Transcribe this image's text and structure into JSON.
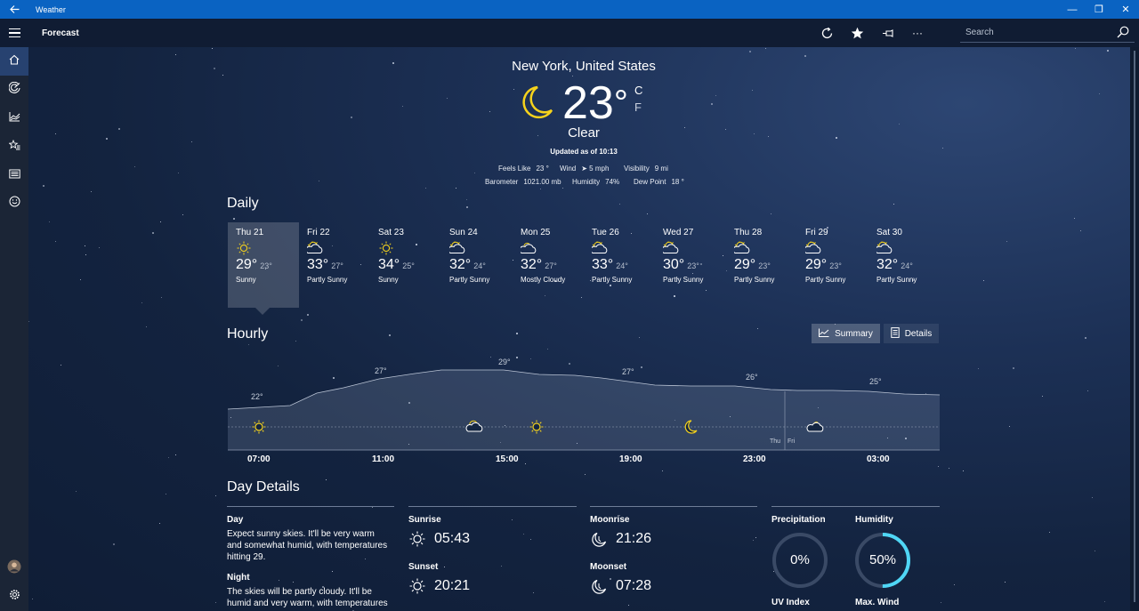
{
  "window": {
    "app_title": "Weather",
    "back_icon": "back-arrow-icon",
    "minimize": "—",
    "restore": "❐",
    "close": "✕"
  },
  "command_bar": {
    "title": "Forecast",
    "search_placeholder": "Search",
    "more": "···"
  },
  "current": {
    "location": "New York, United States",
    "temperature": "23",
    "degree": "°",
    "unit_c": "C",
    "unit_f": "F",
    "condition": "Clear",
    "updated": "Updated as of 10:13",
    "feels_like_label": "Feels Like",
    "feels_like": "23 °",
    "wind_label": "Wind",
    "wind": "➤ 5 mph",
    "visibility_label": "Visibility",
    "visibility": "9 mi",
    "barometer_label": "Barometer",
    "barometer": "1021.00 mb",
    "humidity_label": "Humidity",
    "humidity": "74%",
    "dewpoint_label": "Dew Point",
    "dewpoint": "18 °"
  },
  "daily": {
    "heading": "Daily",
    "days": [
      {
        "name": "Thu 21",
        "hi": "29°",
        "lo": "23°",
        "cond": "Sunny",
        "icon": "sun-icon"
      },
      {
        "name": "Fri 22",
        "hi": "33°",
        "lo": "27°",
        "cond": "Partly Sunny",
        "icon": "partly-sunny-icon"
      },
      {
        "name": "Sat 23",
        "hi": "34°",
        "lo": "25°",
        "cond": "Sunny",
        "icon": "sun-icon"
      },
      {
        "name": "Sun 24",
        "hi": "32°",
        "lo": "24°",
        "cond": "Partly Sunny",
        "icon": "partly-sunny-icon"
      },
      {
        "name": "Mon 25",
        "hi": "32°",
        "lo": "27°",
        "cond": "Mostly Cloudy",
        "icon": "mostly-cloudy-icon"
      },
      {
        "name": "Tue 26",
        "hi": "33°",
        "lo": "24°",
        "cond": "Partly Sunny",
        "icon": "partly-sunny-icon"
      },
      {
        "name": "Wed 27",
        "hi": "30°",
        "lo": "23°",
        "cond": "Partly Sunny",
        "icon": "partly-sunny-icon"
      },
      {
        "name": "Thu 28",
        "hi": "29°",
        "lo": "23°",
        "cond": "Partly Sunny",
        "icon": "partly-sunny-icon"
      },
      {
        "name": "Fri 29",
        "hi": "29°",
        "lo": "23°",
        "cond": "Partly Sunny",
        "icon": "partly-sunny-icon"
      },
      {
        "name": "Sat 30",
        "hi": "32°",
        "lo": "24°",
        "cond": "Partly Sunny",
        "icon": "partly-sunny-icon"
      }
    ]
  },
  "hourly": {
    "heading": "Hourly",
    "summary_label": "Summary",
    "details_label": "Details",
    "times": [
      "07:00",
      "11:00",
      "15:00",
      "19:00",
      "23:00",
      "03:00"
    ],
    "temp_labels": [
      "22°",
      "27°",
      "29°",
      "27°",
      "26°",
      "25°"
    ],
    "day_tags": [
      "Thu",
      "Fri"
    ],
    "icons": [
      "sun-icon",
      "partly-sunny-icon",
      "sun-icon",
      "moon-icon",
      "partly-cloudy-night-icon"
    ]
  },
  "day_details": {
    "heading": "Day Details",
    "day_label": "Day",
    "day_text": "Expect sunny skies. It'll be very warm and somewhat humid, with temperatures hitting 29.",
    "night_label": "Night",
    "night_text": "The skies will be partly cloudy. It'll be humid and very warm, with temperatures",
    "sunrise_label": "Sunrise",
    "sunrise": "05:43",
    "sunset_label": "Sunset",
    "sunset": "20:21",
    "moonrise_label": "Moonrise",
    "moonrise": "21:26",
    "moonset_label": "Moonset",
    "moonset": "07:28",
    "precip_label": "Precipitation",
    "precip": "0%",
    "precip_fraction": 0,
    "humidity_label": "Humidity",
    "humidity": "50%",
    "humidity_fraction": 0.5,
    "uv_label": "UV Index",
    "wind_label": "Max. Wind"
  }
}
